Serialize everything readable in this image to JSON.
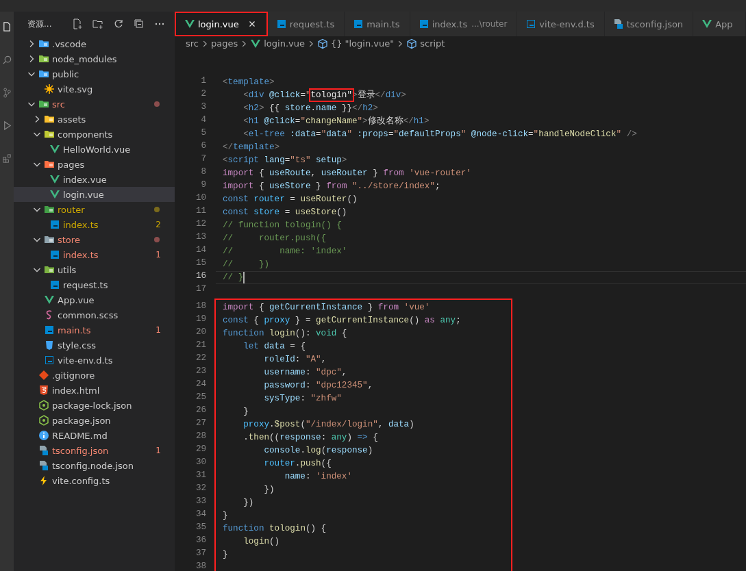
{
  "explorer": {
    "title": "资源...",
    "items": [
      {
        "name": ".vscode",
        "kind": "folder",
        "color": "#42a5f5",
        "expanded": false,
        "selected": false,
        "error": false,
        "warning": false
      },
      {
        "name": "node_modules",
        "kind": "folder",
        "color": "#8bc34a",
        "expanded": false,
        "selected": false,
        "error": false,
        "warning": false
      },
      {
        "name": "public",
        "kind": "folder",
        "color": "#42a5f5",
        "expanded": true,
        "selected": false,
        "error": false,
        "warning": false,
        "children": [
          {
            "name": "vite.svg",
            "kind": "svg",
            "selected": false,
            "error": false,
            "warning": false
          }
        ]
      },
      {
        "name": "src",
        "kind": "folder",
        "color": "#4caf50",
        "expanded": true,
        "selected": false,
        "error": true,
        "warning": false,
        "children": [
          {
            "name": "assets",
            "kind": "folder",
            "color": "#fbc02d",
            "expanded": false,
            "selected": false,
            "error": false,
            "warning": false
          },
          {
            "name": "components",
            "kind": "folder",
            "color": "#c0ca33",
            "expanded": true,
            "selected": false,
            "error": false,
            "warning": false,
            "children": [
              {
                "name": "HelloWorld.vue",
                "kind": "vue",
                "selected": false,
                "error": false,
                "warning": false
              }
            ]
          },
          {
            "name": "pages",
            "kind": "folder",
            "color": "#ff7043",
            "expanded": true,
            "selected": false,
            "error": false,
            "warning": false,
            "children": [
              {
                "name": "index.vue",
                "kind": "vue",
                "selected": false,
                "error": false,
                "warning": false
              },
              {
                "name": "login.vue",
                "kind": "vue",
                "selected": true,
                "error": false,
                "warning": false
              }
            ]
          },
          {
            "name": "router",
            "kind": "folder",
            "color": "#43a047",
            "expanded": true,
            "selected": false,
            "error": false,
            "warning": true,
            "children": [
              {
                "name": "index.ts",
                "kind": "ts",
                "selected": false,
                "error": false,
                "warning": true,
                "badge": "2"
              }
            ]
          },
          {
            "name": "store",
            "kind": "folder",
            "color": "#90a4ae",
            "expanded": true,
            "selected": false,
            "error": true,
            "warning": false,
            "children": [
              {
                "name": "index.ts",
                "kind": "ts",
                "selected": false,
                "error": true,
                "warning": false,
                "badge": "1"
              }
            ]
          },
          {
            "name": "utils",
            "kind": "folder",
            "color": "#7cb342",
            "expanded": true,
            "selected": false,
            "error": false,
            "warning": false,
            "children": [
              {
                "name": "request.ts",
                "kind": "ts",
                "selected": false,
                "error": false,
                "warning": false
              }
            ]
          },
          {
            "name": "App.vue",
            "kind": "vue",
            "selected": false,
            "error": false,
            "warning": false
          },
          {
            "name": "common.scss",
            "kind": "scss",
            "selected": false,
            "error": false,
            "warning": false
          },
          {
            "name": "main.ts",
            "kind": "ts",
            "selected": false,
            "error": true,
            "warning": false,
            "badge": "1"
          },
          {
            "name": "style.css",
            "kind": "css",
            "selected": false,
            "error": false,
            "warning": false
          },
          {
            "name": "vite-env.d.ts",
            "kind": "tsd",
            "selected": false,
            "error": false,
            "warning": false
          }
        ]
      },
      {
        "name": ".gitignore",
        "kind": "git",
        "selected": false,
        "error": false,
        "warning": false
      },
      {
        "name": "index.html",
        "kind": "html",
        "selected": false,
        "error": false,
        "warning": false
      },
      {
        "name": "package-lock.json",
        "kind": "json",
        "selected": false,
        "error": false,
        "warning": false
      },
      {
        "name": "package.json",
        "kind": "json",
        "selected": false,
        "error": false,
        "warning": false
      },
      {
        "name": "README.md",
        "kind": "info",
        "selected": false,
        "error": false,
        "warning": false
      },
      {
        "name": "tsconfig.json",
        "kind": "tsconfig",
        "selected": false,
        "error": true,
        "warning": false,
        "badge": "1"
      },
      {
        "name": "tsconfig.node.json",
        "kind": "tsconfig",
        "selected": false,
        "error": false,
        "warning": false
      },
      {
        "name": "vite.config.ts",
        "kind": "bolt",
        "selected": false,
        "error": false,
        "warning": false
      }
    ]
  },
  "tabs": [
    {
      "label": "login.vue",
      "kind": "vue",
      "selected": true,
      "highlighted": true
    },
    {
      "label": "request.ts",
      "kind": "ts",
      "selected": false,
      "highlighted": false
    },
    {
      "label": "main.ts",
      "kind": "ts",
      "selected": false,
      "highlighted": false
    },
    {
      "label": "index.ts",
      "description": "...\\router",
      "kind": "ts",
      "selected": false,
      "highlighted": false
    },
    {
      "label": "vite-env.d.ts",
      "kind": "tsd",
      "selected": false,
      "highlighted": false
    },
    {
      "label": "tsconfig.json",
      "kind": "tsconfig",
      "selected": false,
      "highlighted": false
    },
    {
      "label": "App",
      "kind": "vue",
      "selected": false,
      "highlighted": false
    }
  ],
  "breadcrumb": [
    {
      "label": "src",
      "kind": "plain"
    },
    {
      "label": "pages",
      "kind": "plain"
    },
    {
      "label": "login.vue",
      "kind": "vue"
    },
    {
      "label": "\"login.vue\"",
      "kind": "object",
      "glyph": "{}"
    },
    {
      "label": "script",
      "kind": "module"
    }
  ],
  "editor": {
    "blocks": [
      {
        "framed": false,
        "lines": [
          {
            "number": "1",
            "current": false,
            "tokens": [
              {
                "kind": "punct",
                "text": "<"
              },
              {
                "kind": "tag",
                "text": "template"
              },
              {
                "kind": "punct",
                "text": ">"
              }
            ]
          },
          {
            "number": "2",
            "current": false,
            "tokens": [
              {
                "kind": "punct",
                "text": "    <"
              },
              {
                "kind": "tag",
                "text": "div "
              },
              {
                "kind": "attr",
                "text": "@click"
              },
              {
                "kind": "plain",
                "text": "="
              },
              {
                "kind": "str",
                "text": "\""
              },
              {
                "kind": "boxed",
                "text": "tologin\""
              },
              {
                "kind": "punct",
                "text": ">"
              },
              {
                "kind": "text",
                "text": "登录"
              },
              {
                "kind": "punct",
                "text": "</"
              },
              {
                "kind": "tag",
                "text": "div"
              },
              {
                "kind": "punct",
                "text": ">"
              }
            ]
          },
          {
            "number": "3",
            "current": false,
            "tokens": [
              {
                "kind": "punct",
                "text": "    <"
              },
              {
                "kind": "tag",
                "text": "h2"
              },
              {
                "kind": "punct",
                "text": ">"
              },
              {
                "kind": "plain",
                "text": " {{ "
              },
              {
                "kind": "var",
                "text": "store"
              },
              {
                "kind": "plain",
                "text": "."
              },
              {
                "kind": "var",
                "text": "name"
              },
              {
                "kind": "plain",
                "text": " }}"
              },
              {
                "kind": "punct",
                "text": "</"
              },
              {
                "kind": "tag",
                "text": "h2"
              },
              {
                "kind": "punct",
                "text": ">"
              }
            ]
          },
          {
            "number": "4",
            "current": false,
            "tokens": [
              {
                "kind": "punct",
                "text": "    <"
              },
              {
                "kind": "tag",
                "text": "h1 "
              },
              {
                "kind": "attr",
                "text": "@click"
              },
              {
                "kind": "plain",
                "text": "="
              },
              {
                "kind": "str",
                "text": "\""
              },
              {
                "kind": "fn",
                "text": "changeName"
              },
              {
                "kind": "str",
                "text": "\""
              },
              {
                "kind": "punct",
                "text": ">"
              },
              {
                "kind": "text",
                "text": "修改名称"
              },
              {
                "kind": "punct",
                "text": "</"
              },
              {
                "kind": "tag",
                "text": "h1"
              },
              {
                "kind": "punct",
                "text": ">"
              }
            ]
          },
          {
            "number": "5",
            "current": false,
            "tokens": [
              {
                "kind": "punct",
                "text": "    <"
              },
              {
                "kind": "tag",
                "text": "el-tree "
              },
              {
                "kind": "attr",
                "text": ":data"
              },
              {
                "kind": "plain",
                "text": "="
              },
              {
                "kind": "str",
                "text": "\""
              },
              {
                "kind": "var",
                "text": "data"
              },
              {
                "kind": "str",
                "text": "\" "
              },
              {
                "kind": "attr",
                "text": ":props"
              },
              {
                "kind": "plain",
                "text": "="
              },
              {
                "kind": "str",
                "text": "\""
              },
              {
                "kind": "var",
                "text": "defaultProps"
              },
              {
                "kind": "str",
                "text": "\" "
              },
              {
                "kind": "attr",
                "text": "@node-click"
              },
              {
                "kind": "plain",
                "text": "="
              },
              {
                "kind": "str",
                "text": "\""
              },
              {
                "kind": "fn",
                "text": "handleNodeClick"
              },
              {
                "kind": "str",
                "text": "\" "
              },
              {
                "kind": "punct",
                "text": "/>"
              }
            ]
          },
          {
            "number": "6",
            "current": false,
            "tokens": [
              {
                "kind": "punct",
                "text": "</"
              },
              {
                "kind": "tag",
                "text": "template"
              },
              {
                "kind": "punct",
                "text": ">"
              }
            ]
          },
          {
            "number": "7",
            "current": false,
            "tokens": [
              {
                "kind": "punct",
                "text": "<"
              },
              {
                "kind": "tag",
                "text": "script "
              },
              {
                "kind": "attr",
                "text": "lang"
              },
              {
                "kind": "plain",
                "text": "="
              },
              {
                "kind": "str",
                "text": "\"ts\" "
              },
              {
                "kind": "attr",
                "text": "setup"
              },
              {
                "kind": "punct",
                "text": ">"
              }
            ]
          },
          {
            "number": "8",
            "current": false,
            "tokens": [
              {
                "kind": "kw",
                "text": "import"
              },
              {
                "kind": "plain",
                "text": " { "
              },
              {
                "kind": "var",
                "text": "useRoute"
              },
              {
                "kind": "plain",
                "text": ", "
              },
              {
                "kind": "var",
                "text": "useRouter"
              },
              {
                "kind": "plain",
                "text": " } "
              },
              {
                "kind": "kw",
                "text": "from "
              },
              {
                "kind": "str",
                "text": "'vue-router'"
              }
            ]
          },
          {
            "number": "9",
            "current": false,
            "tokens": [
              {
                "kind": "kw",
                "text": "import"
              },
              {
                "kind": "plain",
                "text": " { "
              },
              {
                "kind": "var",
                "text": "useStore"
              },
              {
                "kind": "plain",
                "text": " } "
              },
              {
                "kind": "kw",
                "text": "from "
              },
              {
                "kind": "str",
                "text": "\"../store/index\""
              },
              {
                "kind": "plain",
                "text": ";"
              }
            ]
          },
          {
            "number": "10",
            "current": false,
            "tokens": [
              {
                "kind": "decl",
                "text": "const "
              },
              {
                "kind": "const",
                "text": "router"
              },
              {
                "kind": "plain",
                "text": " = "
              },
              {
                "kind": "fn",
                "text": "useRouter"
              },
              {
                "kind": "plain",
                "text": "()"
              }
            ]
          },
          {
            "number": "11",
            "current": false,
            "tokens": [
              {
                "kind": "decl",
                "text": "const "
              },
              {
                "kind": "const",
                "text": "store"
              },
              {
                "kind": "plain",
                "text": " = "
              },
              {
                "kind": "fn",
                "text": "useStore"
              },
              {
                "kind": "plain",
                "text": "()"
              }
            ]
          },
          {
            "number": "12",
            "current": false,
            "tokens": [
              {
                "kind": "comment",
                "text": "// function tologin() {"
              }
            ]
          },
          {
            "number": "13",
            "current": false,
            "tokens": [
              {
                "kind": "comment",
                "text": "//     router.push({"
              }
            ]
          },
          {
            "number": "14",
            "current": false,
            "tokens": [
              {
                "kind": "comment",
                "text": "//         name: 'index'"
              }
            ]
          },
          {
            "number": "15",
            "current": false,
            "tokens": [
              {
                "kind": "comment",
                "text": "//     })"
              }
            ]
          },
          {
            "number": "16",
            "current": true,
            "tokens": [
              {
                "kind": "comment",
                "text": "// }"
              }
            ]
          },
          {
            "number": "17",
            "current": false
          }
        ]
      },
      {
        "framed": true,
        "lines": [
          {
            "number": "18",
            "current": false,
            "tokens": [
              {
                "kind": "kw",
                "text": "import"
              },
              {
                "kind": "plain",
                "text": " { "
              },
              {
                "kind": "var",
                "text": "getCurrentInstance"
              },
              {
                "kind": "plain",
                "text": " } "
              },
              {
                "kind": "kw",
                "text": "from "
              },
              {
                "kind": "str",
                "text": "'vue'"
              }
            ]
          },
          {
            "number": "19",
            "current": false,
            "tokens": [
              {
                "kind": "decl",
                "text": "const"
              },
              {
                "kind": "plain",
                "text": " { "
              },
              {
                "kind": "const",
                "text": "proxy"
              },
              {
                "kind": "plain",
                "text": " } = "
              },
              {
                "kind": "fn",
                "text": "getCurrentInstance"
              },
              {
                "kind": "plain",
                "text": "() "
              },
              {
                "kind": "kw",
                "text": "as "
              },
              {
                "kind": "type",
                "text": "any"
              },
              {
                "kind": "plain",
                "text": ";"
              }
            ]
          },
          {
            "number": "20",
            "current": false,
            "tokens": [
              {
                "kind": "decl",
                "text": "function "
              },
              {
                "kind": "fn",
                "text": "login"
              },
              {
                "kind": "plain",
                "text": "(): "
              },
              {
                "kind": "type",
                "text": "void"
              },
              {
                "kind": "plain",
                "text": " {"
              }
            ]
          },
          {
            "number": "21",
            "current": false,
            "tokens": [
              {
                "kind": "decl",
                "text": "    let "
              },
              {
                "kind": "var",
                "text": "data"
              },
              {
                "kind": "plain",
                "text": " = {"
              }
            ]
          },
          {
            "number": "22",
            "current": false,
            "tokens": [
              {
                "kind": "var",
                "text": "        roleId"
              },
              {
                "kind": "plain",
                "text": ": "
              },
              {
                "kind": "str",
                "text": "\"A\""
              },
              {
                "kind": "plain",
                "text": ","
              }
            ]
          },
          {
            "number": "23",
            "current": false,
            "tokens": [
              {
                "kind": "var",
                "text": "        username"
              },
              {
                "kind": "plain",
                "text": ": "
              },
              {
                "kind": "str",
                "text": "\"dpc\""
              },
              {
                "kind": "plain",
                "text": ","
              }
            ]
          },
          {
            "number": "24",
            "current": false,
            "tokens": [
              {
                "kind": "var",
                "text": "        password"
              },
              {
                "kind": "plain",
                "text": ": "
              },
              {
                "kind": "str",
                "text": "\"dpc12345\""
              },
              {
                "kind": "plain",
                "text": ","
              }
            ]
          },
          {
            "number": "25",
            "current": false,
            "tokens": [
              {
                "kind": "var",
                "text": "        sysType"
              },
              {
                "kind": "plain",
                "text": ": "
              },
              {
                "kind": "str",
                "text": "\"zhfw\""
              }
            ]
          },
          {
            "number": "26",
            "current": false,
            "tokens": [
              {
                "kind": "plain",
                "text": "    }"
              }
            ]
          },
          {
            "number": "27",
            "current": false,
            "tokens": [
              {
                "kind": "const",
                "text": "    proxy"
              },
              {
                "kind": "plain",
                "text": "."
              },
              {
                "kind": "fn",
                "text": "$post"
              },
              {
                "kind": "plain",
                "text": "("
              },
              {
                "kind": "str",
                "text": "\"/index/login\""
              },
              {
                "kind": "plain",
                "text": ", "
              },
              {
                "kind": "var",
                "text": "data"
              },
              {
                "kind": "plain",
                "text": ")"
              }
            ]
          },
          {
            "number": "28",
            "current": false,
            "tokens": [
              {
                "kind": "plain",
                "text": "    ."
              },
              {
                "kind": "fn",
                "text": "then"
              },
              {
                "kind": "plain",
                "text": "(("
              },
              {
                "kind": "var",
                "text": "response"
              },
              {
                "kind": "plain",
                "text": ": "
              },
              {
                "kind": "type",
                "text": "any"
              },
              {
                "kind": "plain",
                "text": ") "
              },
              {
                "kind": "decl",
                "text": "=>"
              },
              {
                "kind": "plain",
                "text": " {"
              }
            ]
          },
          {
            "number": "29",
            "current": false,
            "tokens": [
              {
                "kind": "var",
                "text": "        console"
              },
              {
                "kind": "plain",
                "text": "."
              },
              {
                "kind": "fn",
                "text": "log"
              },
              {
                "kind": "plain",
                "text": "("
              },
              {
                "kind": "var",
                "text": "response"
              },
              {
                "kind": "plain",
                "text": ")"
              }
            ]
          },
          {
            "number": "30",
            "current": false,
            "tokens": [
              {
                "kind": "const",
                "text": "        router"
              },
              {
                "kind": "plain",
                "text": "."
              },
              {
                "kind": "fn",
                "text": "push"
              },
              {
                "kind": "plain",
                "text": "({"
              }
            ]
          },
          {
            "number": "31",
            "current": false,
            "tokens": [
              {
                "kind": "var",
                "text": "            name"
              },
              {
                "kind": "plain",
                "text": ": "
              },
              {
                "kind": "str",
                "text": "'index'"
              }
            ]
          },
          {
            "number": "32",
            "current": false,
            "tokens": [
              {
                "kind": "plain",
                "text": "        })"
              }
            ]
          },
          {
            "number": "33",
            "current": false,
            "tokens": [
              {
                "kind": "plain",
                "text": "    })"
              }
            ]
          },
          {
            "number": "34",
            "current": false,
            "tokens": [
              {
                "kind": "plain",
                "text": "}"
              }
            ]
          },
          {
            "number": "35",
            "current": false,
            "tokens": [
              {
                "kind": "decl",
                "text": "function "
              },
              {
                "kind": "fn",
                "text": "tologin"
              },
              {
                "kind": "plain",
                "text": "() {"
              }
            ]
          },
          {
            "number": "36",
            "current": false,
            "tokens": [
              {
                "kind": "fn",
                "text": "    login"
              },
              {
                "kind": "plain",
                "text": "()"
              }
            ]
          },
          {
            "number": "37",
            "current": false,
            "tokens": [
              {
                "kind": "plain",
                "text": "}"
              }
            ]
          },
          {
            "number": "38",
            "current": false
          }
        ]
      }
    ]
  }
}
